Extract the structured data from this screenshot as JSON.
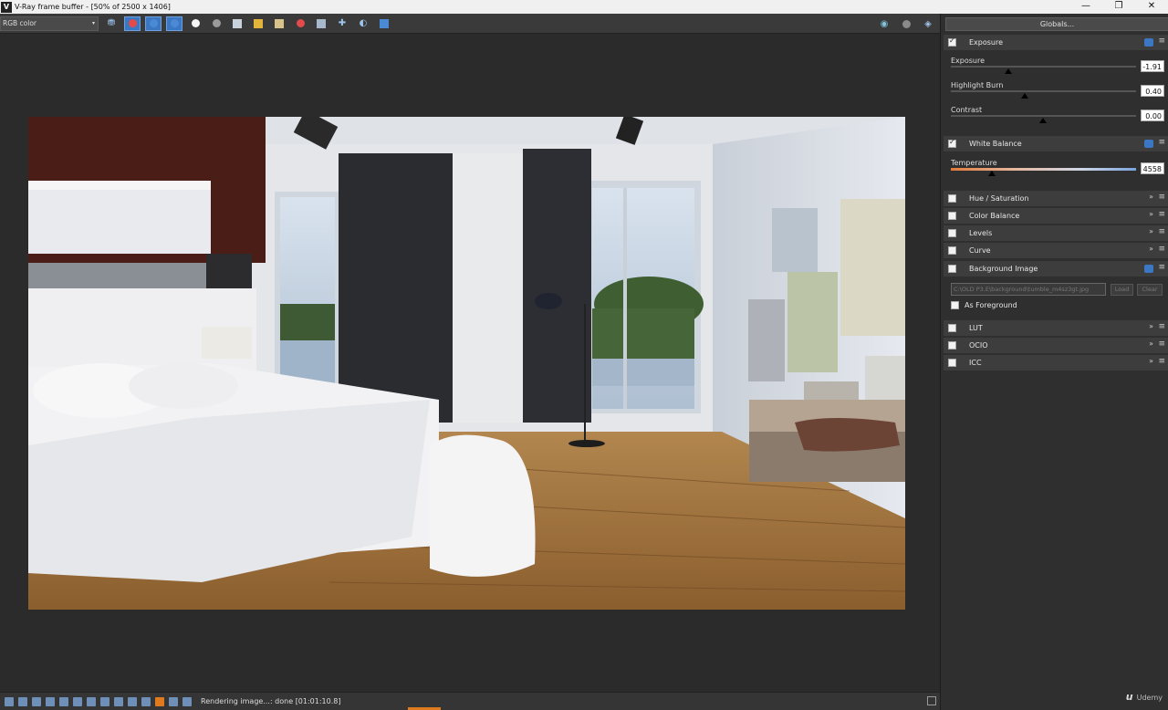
{
  "window": {
    "title": "V-Ray frame buffer - [50% of 2500 x 1406]",
    "logo_letter": "V",
    "minimize": "—",
    "restore": "❐",
    "close": "✕"
  },
  "toolbar": {
    "channel": "RGB color",
    "channel_arrow": "▾",
    "buttons": [
      {
        "name": "save-icon",
        "glyph": "🖫"
      },
      {
        "name": "red-channel-icon",
        "color": "#d9534f"
      },
      {
        "name": "green-channel-icon",
        "color": "#3c77c4"
      },
      {
        "name": "blue-channel-icon",
        "color": "#3c77c4"
      }
    ],
    "colors": {
      "red": "#e34b4b",
      "accent": "#3c77c4",
      "highlight": "#e07a1f"
    }
  },
  "panel": {
    "globals_label": "Globals...",
    "sections": {
      "exposure": "Exposure",
      "white_balance": "White Balance",
      "hue_saturation": "Hue / Saturation",
      "color_balance": "Color Balance",
      "levels": "Levels",
      "curve": "Curve",
      "background_image": "Background Image",
      "lut": "LUT",
      "ocio": "OCIO",
      "icc": "ICC"
    },
    "sliders": {
      "exposure": {
        "label": "Exposure",
        "value": "-1.91",
        "level": 0.31
      },
      "highlight_burn": {
        "label": "Highlight Burn",
        "value": "0.40",
        "level": 0.4
      },
      "contrast": {
        "label": "Contrast",
        "value": "0.00",
        "level": 0.5
      },
      "temperature": {
        "label": "Temperature",
        "value": "4558",
        "level": 0.22
      }
    },
    "background": {
      "path": "C:\\OLD P3.E\\background\\tumble_m4sz3gt.jpg",
      "load": "Load",
      "clear": "Clear",
      "as_foreground": "As Foreground"
    },
    "menu_glyph": "≡",
    "chevron_glyph": "»"
  },
  "status": {
    "text": "Rendering image...: done [01:01:10.8]"
  },
  "watermark": {
    "logo": "u",
    "text": "Udemy"
  }
}
